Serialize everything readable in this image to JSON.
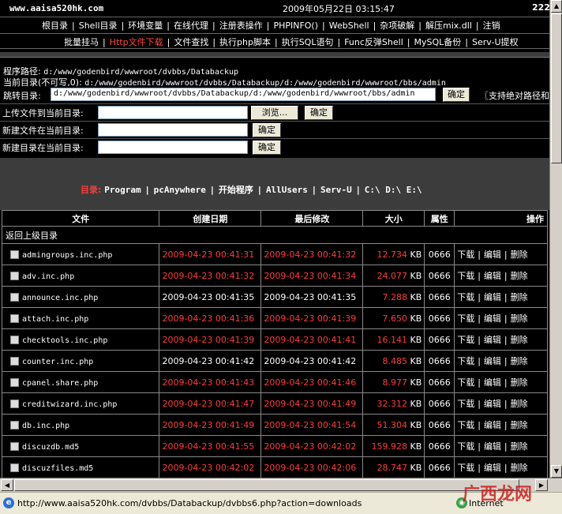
{
  "header": {
    "site": "www.aaisa520hk.com",
    "datetime": "2009年05月22日 03:15:47",
    "right_num": "222"
  },
  "menu1": [
    "根目录",
    "Shell目录",
    "环境变量",
    "在线代理",
    "注册表操作",
    "PHPINFO()",
    "WebShell",
    "杂项破解",
    "解压mix.dll",
    "注销"
  ],
  "menu2": [
    "批量挂马",
    "Http文件下载",
    "文件查找",
    "执行php脚本",
    "执行SQL语句",
    "Func反弹Shell",
    "MySQL备份",
    "Serv-U提权"
  ],
  "menu2_active": 1,
  "info": {
    "program_path_label": "程序路径:",
    "program_path": "d:/www/godenbird/wwwroot/dvbbs/Databackup",
    "current_dir_label": "当前目录(不可写,0):",
    "current_dir": "d:/www/godenbird/wwwroot/dvbbs/Databackup/d:/www/godenbird/wwwroot/bbs/admin",
    "jump_label": "跳转目录:",
    "jump_value": "d:/www/godenbird/wwwroot/dvbbs/Databackup/d:/www/godenbird/wwwroot/bbs/admin",
    "confirm": "确定",
    "abs_note": "〖支持绝对路径和",
    "upload_label": "上传文件到当前目录:",
    "browse": "浏览...",
    "newfile_label": "新建文件在当前目录:",
    "newdir_label": "新建目录在当前目录:"
  },
  "dirs": {
    "label": "目录:",
    "links": [
      "Program",
      "pcAnywhere",
      "开始程序",
      "AllUsers",
      "Serv-U"
    ],
    "drives": "C:\\ D:\\ E:\\"
  },
  "table": {
    "headers": [
      "文件",
      "创建日期",
      "最后修改",
      "大小",
      "属性",
      "操作"
    ],
    "back": "返回上级目录",
    "ops": [
      "下载",
      "编辑",
      "删除"
    ],
    "rows": [
      {
        "name": "admingroups.inc.php",
        "created": "2009-04-23 00:41:31",
        "modified": "2009-04-23 00:41:32",
        "size": "12.734",
        "attr": "0666",
        "red": true
      },
      {
        "name": "adv.inc.php",
        "created": "2009-04-23 00:41:32",
        "modified": "2009-04-23 00:41:34",
        "size": "24.077",
        "attr": "0666",
        "red": true
      },
      {
        "name": "announce.inc.php",
        "created": "2009-04-23 00:41:35",
        "modified": "2009-04-23 00:41:35",
        "size": "7.288",
        "attr": "0666",
        "red": false
      },
      {
        "name": "attach.inc.php",
        "created": "2009-04-23 00:41:36",
        "modified": "2009-04-23 00:41:39",
        "size": "7.650",
        "attr": "0666",
        "red": true
      },
      {
        "name": "checktools.inc.php",
        "created": "2009-04-23 00:41:39",
        "modified": "2009-04-23 00:41:41",
        "size": "16.141",
        "attr": "0666",
        "red": true
      },
      {
        "name": "counter.inc.php",
        "created": "2009-04-23 00:41:42",
        "modified": "2009-04-23 00:41:42",
        "size": "8.485",
        "attr": "0666",
        "red": false
      },
      {
        "name": "cpanel.share.php",
        "created": "2009-04-23 00:41:43",
        "modified": "2009-04-23 00:41:46",
        "size": "8.977",
        "attr": "0666",
        "red": true
      },
      {
        "name": "creditwizard.inc.php",
        "created": "2009-04-23 00:41:47",
        "modified": "2009-04-23 00:41:49",
        "size": "32.312",
        "attr": "0666",
        "red": true
      },
      {
        "name": "db.inc.php",
        "created": "2009-04-23 00:41:49",
        "modified": "2009-04-23 00:41:54",
        "size": "51.304",
        "attr": "0666",
        "red": true
      },
      {
        "name": "discuzdb.md5",
        "created": "2009-04-23 00:41:55",
        "modified": "2009-04-23 00:42:02",
        "size": "159.928",
        "attr": "0666",
        "red": true
      },
      {
        "name": "discuzfiles.md5",
        "created": "2009-04-23 00:42:02",
        "modified": "2009-04-23 00:42:06",
        "size": "28.747",
        "attr": "0666",
        "red": true
      }
    ],
    "size_unit": "KB"
  },
  "status": {
    "url": "http://www.aaisa520hk.com/dvbbs/Databackup/dvbbs6.php?action=downloads",
    "zone": "Internet"
  },
  "watermark": "广西龙网"
}
